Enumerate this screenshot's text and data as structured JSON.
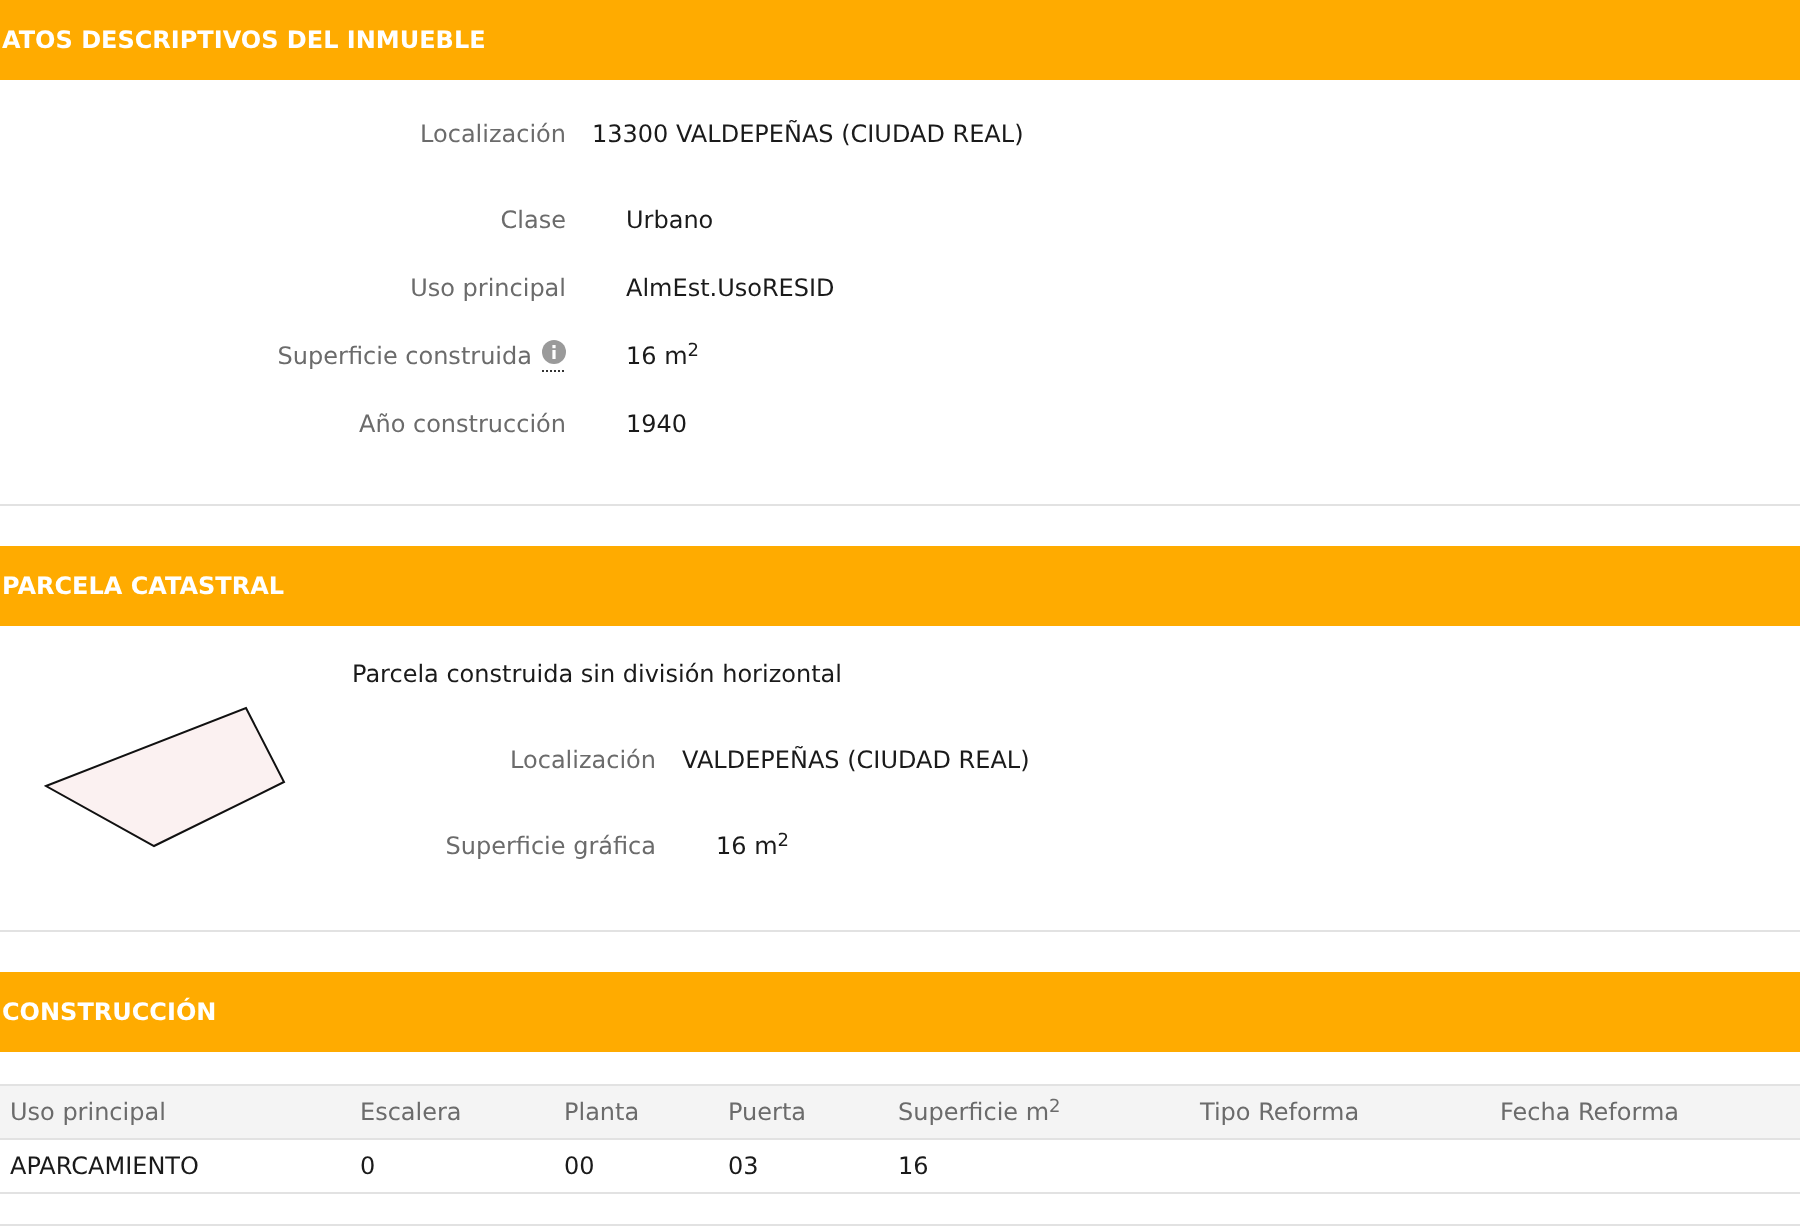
{
  "sections": [
    {
      "kind": "fields",
      "title": "ATOS DESCRIPTIVOS DEL INMUEBLE",
      "fields": [
        {
          "kind": "location",
          "label": "Localización",
          "value": "13300 VALDEPEÑAS (CIUDAD REAL)",
          "info": false
        },
        {
          "kind": "text",
          "label": "Clase",
          "value": "Urbano",
          "info": false
        },
        {
          "kind": "text",
          "label": "Uso principal",
          "value": "AlmEst.UsoRESID",
          "info": false
        },
        {
          "kind": "text",
          "label": "Superficie construida",
          "value": "16 m$^{2}$",
          "info": true
        },
        {
          "kind": "text",
          "label": "Año construcción",
          "value": "1940",
          "info": false
        }
      ]
    },
    {
      "kind": "parcel",
      "title": "PARCELA CATASTRAL",
      "description": "Parcela construida sin división horizontal",
      "fields": [
        {
          "kind": "location",
          "label": "Localización",
          "value": "VALDEPEÑAS (CIUDAD REAL)",
          "info": false
        },
        {
          "kind": "text",
          "label": "Superficie gráfica",
          "value": "16 m$^{2}$",
          "info": false
        }
      ]
    },
    {
      "kind": "table",
      "title": "CONSTRUCCIÓN",
      "columns": [
        "Uso principal",
        "Escalera",
        "Planta",
        "Puerta",
        "Superficie m$^{2}$",
        "Tipo Reforma",
        "Fecha Reforma"
      ],
      "rows": [
        {
          "cells": [
            "APARCAMIENTO",
            "0",
            "00",
            "03",
            "16"
          ]
        }
      ]
    }
  ]
}
